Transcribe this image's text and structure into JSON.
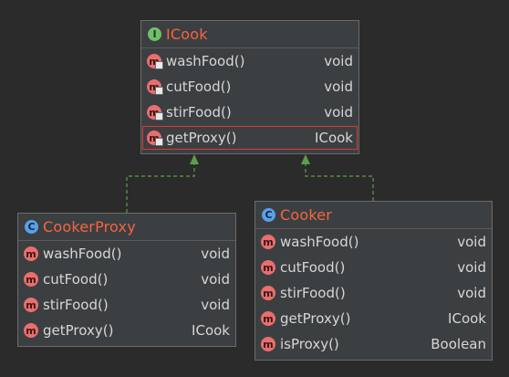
{
  "interface_box": {
    "badge": "I",
    "title": "ICook",
    "members": [
      {
        "icon": "method-abstract-icon",
        "name": "washFood()",
        "type": "void"
      },
      {
        "icon": "method-abstract-icon",
        "name": "cutFood()",
        "type": "void"
      },
      {
        "icon": "method-abstract-icon",
        "name": "stirFood()",
        "type": "void"
      },
      {
        "icon": "method-abstract-icon",
        "name": "getProxy()",
        "type": "ICook",
        "highlighted": true
      }
    ]
  },
  "proxy_box": {
    "badge": "C",
    "title": "CookerProxy",
    "members": [
      {
        "icon": "method-icon",
        "name": "washFood()",
        "type": "void"
      },
      {
        "icon": "method-icon",
        "name": "cutFood()",
        "type": "void"
      },
      {
        "icon": "method-icon",
        "name": "stirFood()",
        "type": "void"
      },
      {
        "icon": "method-icon",
        "name": "getProxy()",
        "type": "ICook"
      }
    ]
  },
  "cooker_box": {
    "badge": "C",
    "title": "Cooker",
    "members": [
      {
        "icon": "method-icon",
        "name": "washFood()",
        "type": "void"
      },
      {
        "icon": "method-icon",
        "name": "cutFood()",
        "type": "void"
      },
      {
        "icon": "method-icon",
        "name": "stirFood()",
        "type": "void"
      },
      {
        "icon": "method-icon",
        "name": "getProxy()",
        "type": "ICook"
      },
      {
        "icon": "method-icon",
        "name": "isProxy()",
        "type": "Boolean"
      }
    ]
  },
  "method_icon_letter": "m",
  "colors": {
    "background": "#2b2b2b",
    "box": "#3c3f41",
    "title": "#f5653f",
    "text": "#d6d6d6",
    "method_icon": "#e96e6e",
    "interface_badge": "#6fbf6a",
    "class_badge": "#5aa0e6",
    "connector": "#5e9e4a",
    "highlight": "#d93a3a"
  }
}
